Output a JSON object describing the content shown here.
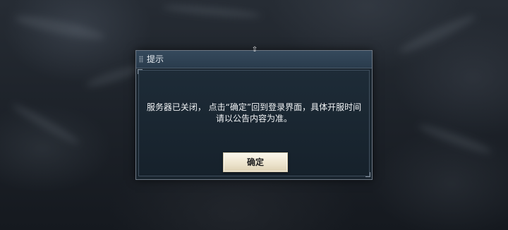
{
  "dialog": {
    "title": "提示",
    "message_line1": "服务器已关闭， 点击“确定”回到登录界面，具体开服时间",
    "message_line2": "请以公告内容为准。",
    "confirm_label": "确定"
  },
  "icons": {
    "title_drag": "drag-handle-icon",
    "top_pin": "pin-icon"
  },
  "colors": {
    "titlebar": "#2f4356",
    "panel": "#1e2c38",
    "button": "#f3ecd9",
    "text": "#f0f2f4"
  }
}
